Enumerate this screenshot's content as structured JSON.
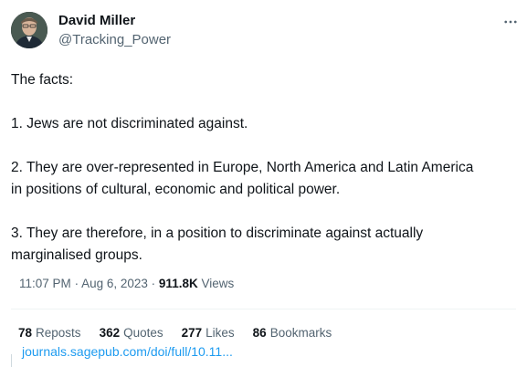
{
  "user": {
    "name": "David Miller",
    "handle": "@Tracking_Power"
  },
  "tweet": {
    "lines": [
      "The facts:",
      "",
      "1. Jews are not discriminated against.",
      "",
      "2. They are over-represented in Europe, North America and Latin America",
      "in positions of cultural, economic and political power.",
      "",
      "3. They are therefore, in a position to discriminate against actually",
      "marginalised groups."
    ]
  },
  "meta": {
    "time": "11:07 PM",
    "separator": "·",
    "date": "Aug 6, 2023",
    "views_count": "911.8K",
    "views_label": "Views"
  },
  "stats": {
    "reposts_count": "78",
    "reposts_label": "Reposts",
    "quotes_count": "362",
    "quotes_label": "Quotes",
    "likes_count": "277",
    "likes_label": "Likes",
    "bookmarks_count": "86",
    "bookmarks_label": "Bookmarks"
  },
  "link_preview": {
    "url": "journals.sagepub.com/doi/full/10.11..."
  },
  "icons": {
    "more": "more-horizontal-icon"
  },
  "colors": {
    "text_primary": "#0f1419",
    "text_secondary": "#536471",
    "link": "#1d9bf0"
  }
}
